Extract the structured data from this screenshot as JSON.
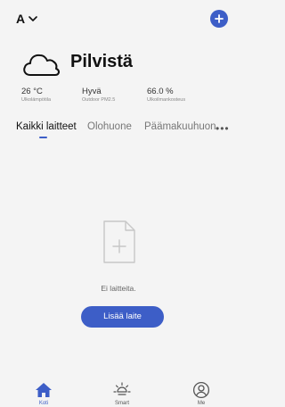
{
  "header": {
    "home_name": "A",
    "dropdown_icon": "chevron-down-icon",
    "add_icon": "plus-circle-icon"
  },
  "weather": {
    "icon": "cloud-icon",
    "condition": "Pilvistä",
    "stats": [
      {
        "value": "26 °C",
        "label": "Ulkolämpötila"
      },
      {
        "value": "Hyvä",
        "label": "Outdoor PM2.5"
      },
      {
        "value": "66.0 %",
        "label": "Ulkoilmankosteus"
      }
    ]
  },
  "tabs": {
    "items": [
      "Kaikki laitteet",
      "Olohuone",
      "Päämakuuhuon"
    ],
    "active_index": 0,
    "more_label": "•••"
  },
  "empty_state": {
    "icon": "empty-document-plus-icon",
    "message": "Ei laitteita.",
    "button_label": "Lisää laite"
  },
  "bottom_nav": {
    "items": [
      {
        "label": "Koti",
        "icon": "home-icon",
        "active": true
      },
      {
        "label": "Smart",
        "icon": "sun-icon",
        "active": false
      },
      {
        "label": "Me",
        "icon": "user-icon",
        "active": false
      }
    ]
  },
  "colors": {
    "accent": "#3d5ec7",
    "background": "#f4f4f4",
    "text_primary": "#111111",
    "text_secondary": "#777777"
  }
}
